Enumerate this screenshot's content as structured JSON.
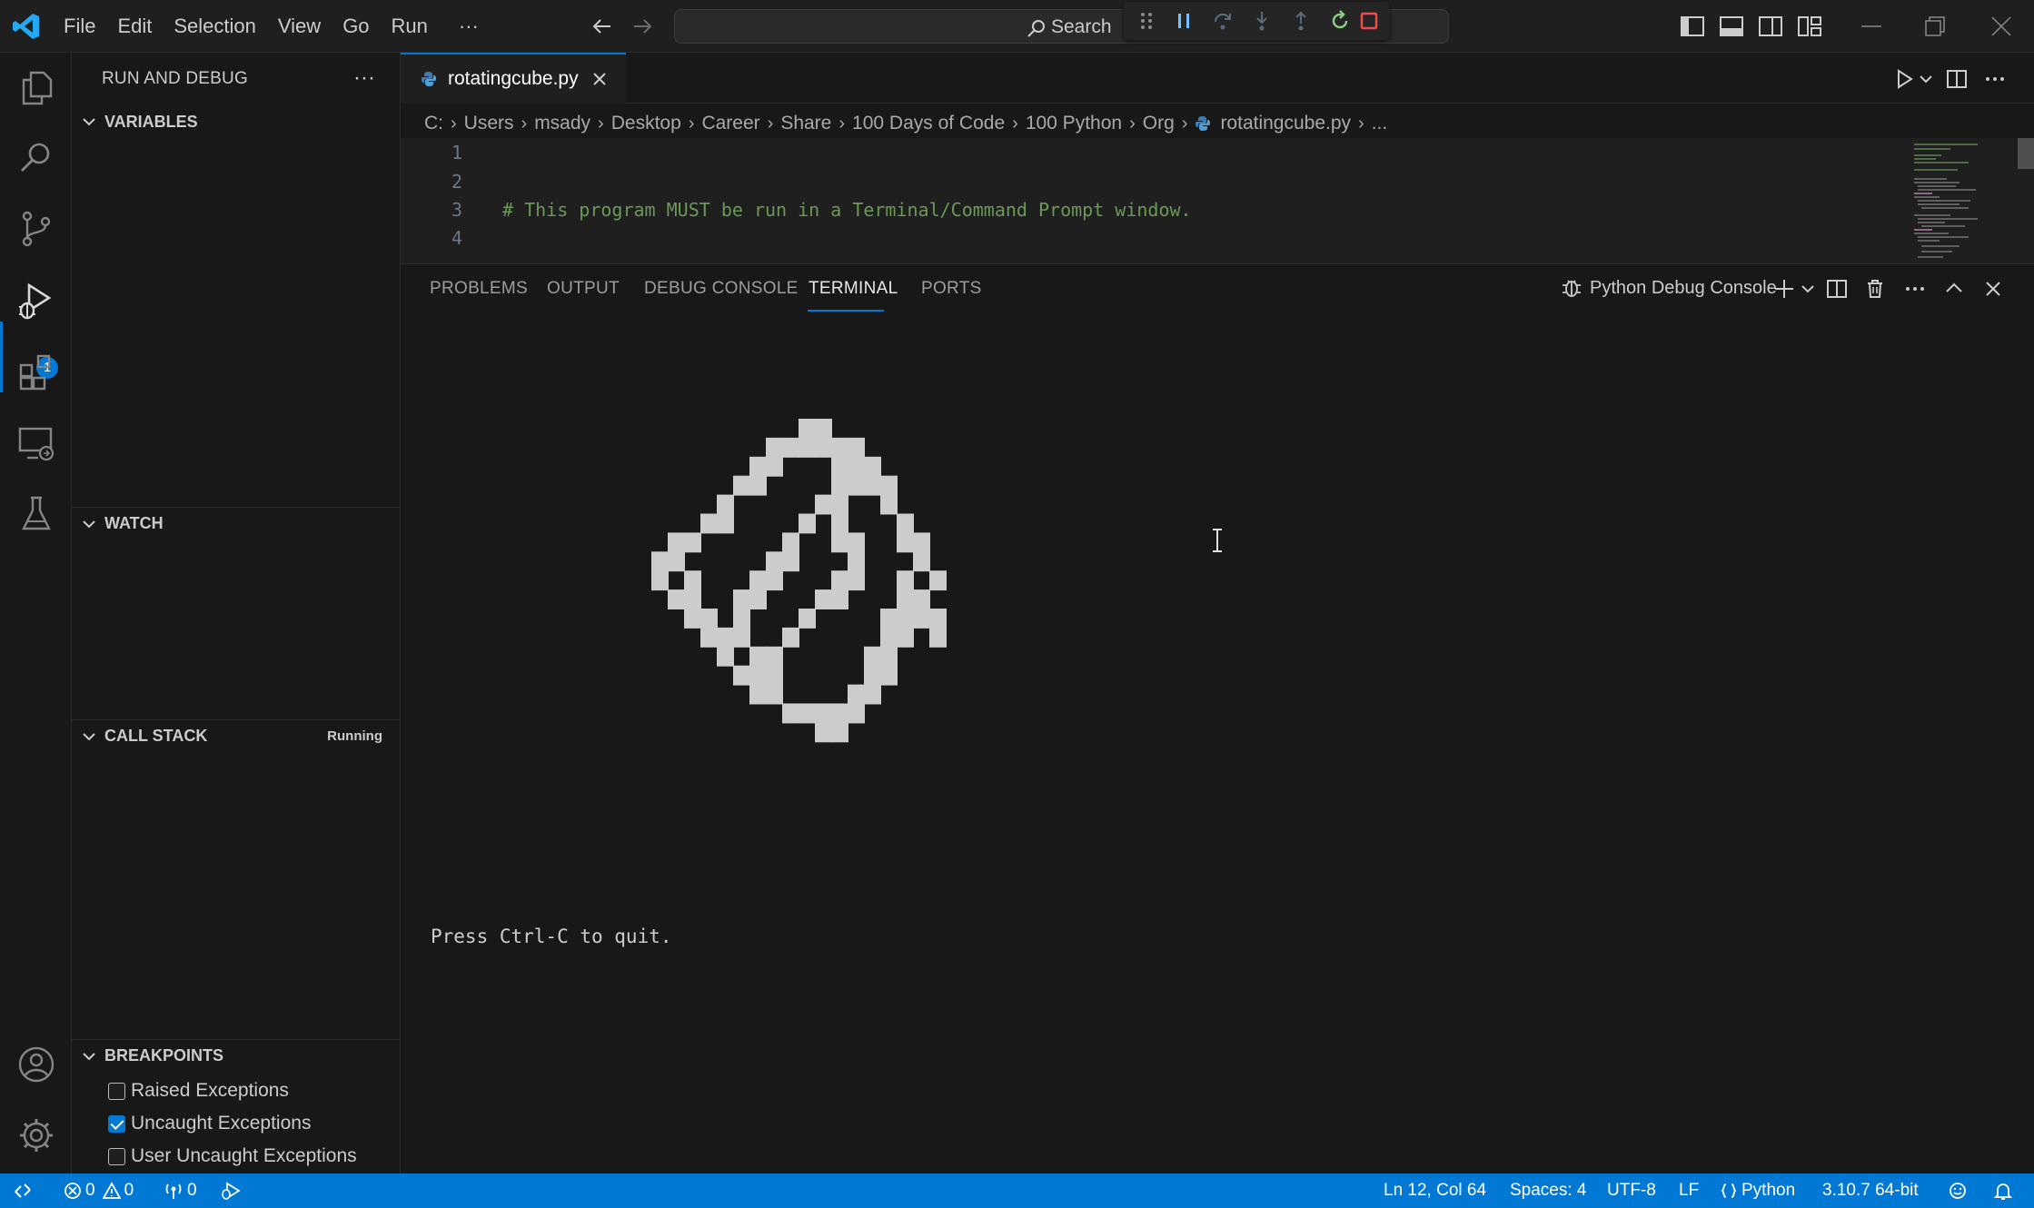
{
  "titlebar": {
    "menu": [
      "File",
      "Edit",
      "Selection",
      "View",
      "Go",
      "Run"
    ],
    "more": "···",
    "search_label": "Search"
  },
  "activity": {
    "items": [
      "explorer-icon",
      "search-icon",
      "source-control-icon",
      "run-debug-icon",
      "extensions-icon",
      "remote-explorer-icon",
      "testing-icon"
    ],
    "run_badge": "1",
    "bottom": [
      "account-icon",
      "settings-gear-icon"
    ]
  },
  "sidebar": {
    "title": "RUN AND DEBUG",
    "more": "···",
    "sections": {
      "variables": "VARIABLES",
      "watch": "WATCH",
      "call_stack": "CALL STACK",
      "call_stack_status": "Running",
      "breakpoints": "BREAKPOINTS"
    },
    "breakpoints": [
      {
        "label": "Raised Exceptions",
        "checked": false
      },
      {
        "label": "Uncaught Exceptions",
        "checked": true
      },
      {
        "label": "User Uncaught Exceptions",
        "checked": false
      }
    ]
  },
  "editor": {
    "tab_label": "rotatingcube.py",
    "breadcrumb": [
      "C:",
      "Users",
      "msady",
      "Desktop",
      "Career",
      "Share",
      "100 Days of Code",
      "100 Python",
      "Org",
      "rotatingcube.py",
      "..."
    ],
    "lines": [
      {
        "n": "1",
        "text": ""
      },
      {
        "n": "2",
        "text": ""
      },
      {
        "n": "3",
        "text": "# This program MUST be run in a Terminal/Command Prompt window."
      },
      {
        "n": "4",
        "text": ""
      }
    ]
  },
  "panel": {
    "tabs": [
      "PROBLEMS",
      "OUTPUT",
      "DEBUG CONSOLE",
      "TERMINAL",
      "PORTS"
    ],
    "active_tab": "TERMINAL",
    "session": "Python Debug Console",
    "terminal_text": "Press Ctrl-C to quit."
  },
  "statusbar": {
    "errors": "0",
    "warnings": "0",
    "ports": "0",
    "position": "Ln 12, Col 64",
    "spaces": "Spaces: 4",
    "encoding": "UTF-8",
    "eol": "LF",
    "language": "Python",
    "interpreter": "3.10.7 64-bit"
  },
  "colors": {
    "accent": "#0078d4",
    "comment": "#6a9955",
    "background": "#181818",
    "run_green": "#89d185",
    "stop_red": "#f14c4c"
  }
}
